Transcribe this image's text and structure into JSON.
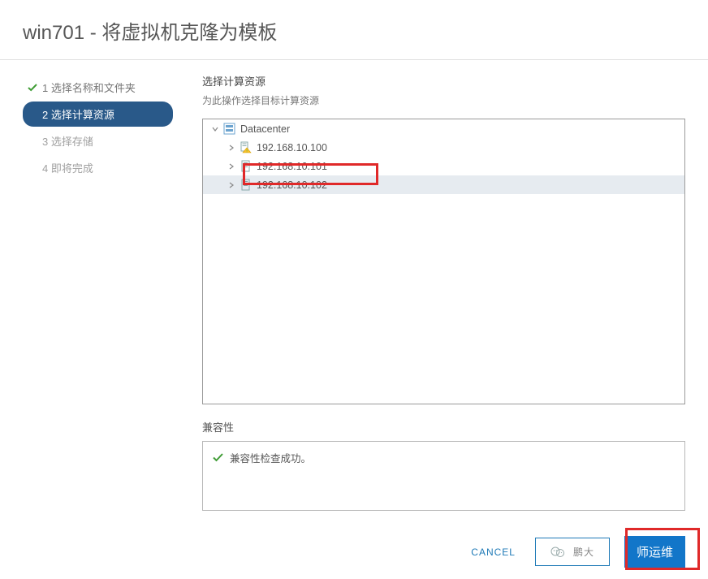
{
  "dialog": {
    "title": "win701 - 将虚拟机克隆为模板"
  },
  "wizard": {
    "steps": [
      {
        "label": "1 选择名称和文件夹",
        "state": "completed"
      },
      {
        "label": "2 选择计算资源",
        "state": "active"
      },
      {
        "label": "3 选择存储",
        "state": "pending"
      },
      {
        "label": "4 即将完成",
        "state": "pending"
      }
    ]
  },
  "main": {
    "heading": "选择计算资源",
    "subheading": "为此操作选择目标计算资源"
  },
  "tree": {
    "root": {
      "label": "Datacenter",
      "expanded": true
    },
    "hosts": [
      {
        "label": "192.168.10.100",
        "warning": true,
        "selected": false
      },
      {
        "label": "192.168.10.101",
        "warning": false,
        "selected": false
      },
      {
        "label": "192.168.10.102",
        "warning": false,
        "selected": true
      }
    ]
  },
  "compat": {
    "heading": "兼容性",
    "message": "兼容性检查成功。"
  },
  "footer": {
    "cancel": "CANCEL",
    "back_icon_only": true,
    "next": "师运维",
    "watermark_prefix": "鹏大"
  }
}
